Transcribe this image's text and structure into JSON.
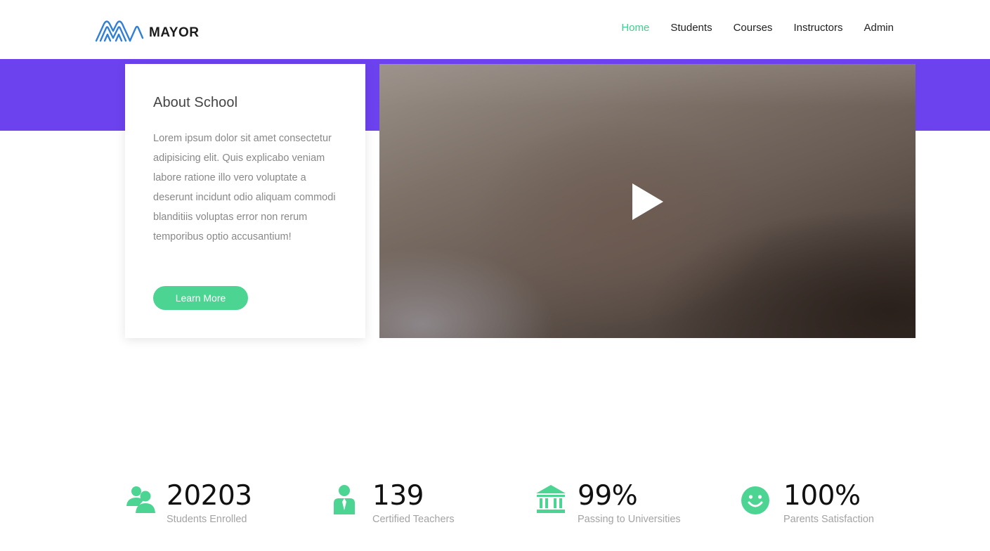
{
  "header": {
    "logo_text": "MAYOR",
    "nav": [
      {
        "label": "Home",
        "active": true
      },
      {
        "label": "Students",
        "active": false
      },
      {
        "label": "Courses",
        "active": false
      },
      {
        "label": "Instructors",
        "active": false
      },
      {
        "label": "Admin",
        "active": false
      }
    ]
  },
  "about": {
    "title": "About School",
    "text": "Lorem ipsum dolor sit amet consectetur adipisicing elit. Quis explicabo veniam labore ratione illo vero voluptate a deserunt incidunt odio aliquam commodi blanditiis voluptas error non rerum temporibus optio accusantium!",
    "button_label": "Learn More"
  },
  "video": {
    "play_icon": "play-icon"
  },
  "stats": [
    {
      "icon": "users-icon",
      "value": "20203",
      "label": "Students Enrolled"
    },
    {
      "icon": "teacher-icon",
      "value": "139",
      "label": "Certified Teachers"
    },
    {
      "icon": "university-icon",
      "value": "99%",
      "label": "Passing to Universities"
    },
    {
      "icon": "smile-icon",
      "value": "100%",
      "label": "Parents Satisfaction"
    }
  ],
  "colors": {
    "accent": "#3fcf8e",
    "button": "#4cd493",
    "band": "#6c42ef",
    "logo_blue": "#2f7fd8"
  }
}
